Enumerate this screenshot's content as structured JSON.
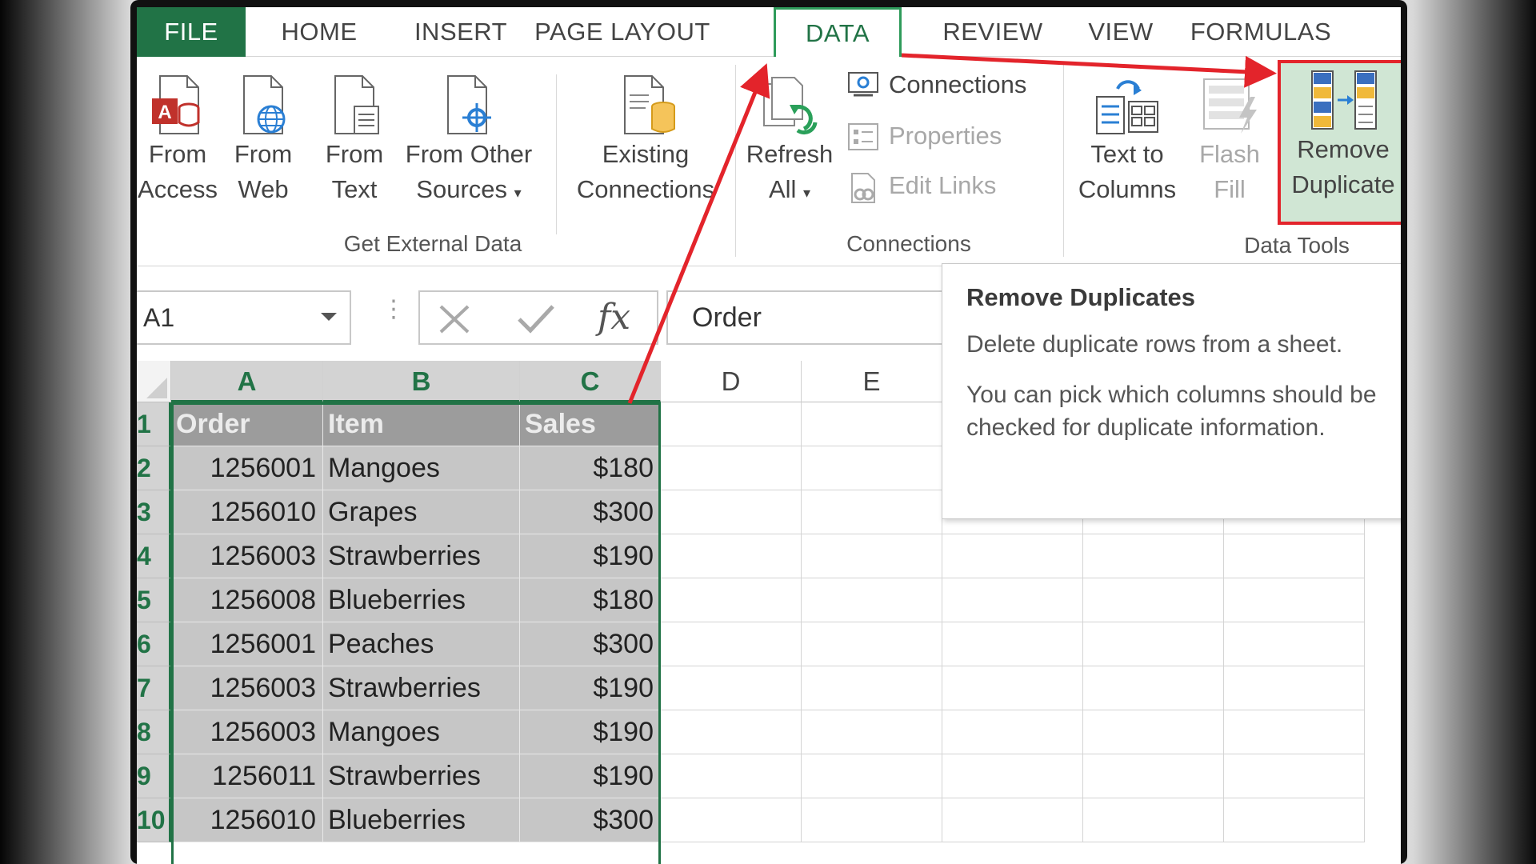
{
  "tabs": [
    {
      "label": "FILE"
    },
    {
      "label": "HOME"
    },
    {
      "label": "INSERT"
    },
    {
      "label": "PAGE LAYOUT"
    },
    {
      "label": "DATA"
    },
    {
      "label": "REVIEW"
    },
    {
      "label": "VIEW"
    },
    {
      "label": "FORMULAS"
    }
  ],
  "active_tab": "DATA",
  "ribbon": {
    "get_external_data": {
      "group_label": "Get External Data",
      "from_access": {
        "line1": "From",
        "line2": "Access"
      },
      "from_web": {
        "line1": "From",
        "line2": "Web"
      },
      "from_text": {
        "line1": "From",
        "line2": "Text"
      },
      "from_other": {
        "line1": "From Other",
        "line2": "Sources"
      },
      "existing": {
        "line1": "Existing",
        "line2": "Connections"
      }
    },
    "connections": {
      "group_label": "Connections",
      "refresh_all": {
        "line1": "Refresh",
        "line2": "All"
      },
      "connections_label": "Connections",
      "properties_label": "Properties",
      "edit_links_label": "Edit Links"
    },
    "data_tools": {
      "group_label": "Data Tools",
      "text_to_columns": {
        "line1": "Text to",
        "line2": "Columns"
      },
      "flash_fill": {
        "line1": "Flash",
        "line2": "Fill"
      },
      "remove_duplicates": {
        "line1": "Remove",
        "line2": "Duplicate"
      }
    }
  },
  "formula_bar": {
    "name_box": "A1",
    "formula": "Order",
    "fx": "fx"
  },
  "sheet": {
    "columns": [
      "A",
      "B",
      "C",
      "D",
      "E"
    ],
    "rows": [
      {
        "n": "1",
        "order": "Order",
        "item": "Item",
        "sales": "Sales"
      },
      {
        "n": "2",
        "order": "1256001",
        "item": "Mangoes",
        "sales": "$180"
      },
      {
        "n": "3",
        "order": "1256010",
        "item": "Grapes",
        "sales": "$300"
      },
      {
        "n": "4",
        "order": "1256003",
        "item": "Strawberries",
        "sales": "$190"
      },
      {
        "n": "5",
        "order": "1256008",
        "item": "Blueberries",
        "sales": "$180"
      },
      {
        "n": "6",
        "order": "1256001",
        "item": "Peaches",
        "sales": "$300"
      },
      {
        "n": "7",
        "order": "1256003",
        "item": "Strawberries",
        "sales": "$190"
      },
      {
        "n": "8",
        "order": "1256003",
        "item": "Mangoes",
        "sales": "$190"
      },
      {
        "n": "9",
        "order": "1256011",
        "item": "Strawberries",
        "sales": "$190"
      },
      {
        "n": "10",
        "order": "1256010",
        "item": "Blueberries",
        "sales": "$300"
      }
    ]
  },
  "tooltip": {
    "title": "Remove Duplicates",
    "line1": "Delete duplicate rows from a sheet.",
    "line2": "You can pick which columns should be checked for duplicate information."
  },
  "colors": {
    "excel_green": "#217346",
    "annotation_red": "#e3242b",
    "selected_fill": "#c6c6c6"
  }
}
